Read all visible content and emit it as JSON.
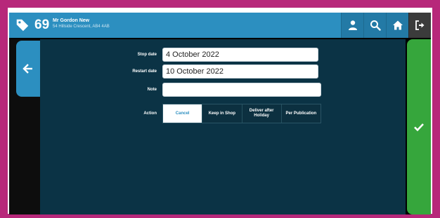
{
  "header": {
    "customer_number": "69",
    "customer_name": "Mr Gordon New",
    "customer_address": "54 Hillside Crescent, AB4 4AB"
  },
  "form": {
    "stop_date_label": "Stop date",
    "stop_date_value": "4 October 2022",
    "restart_date_label": "Restart date",
    "restart_date_value": "10 October 2022",
    "note_label": "Note",
    "note_value": "",
    "action_label": "Action",
    "actions": [
      {
        "label": "Cancel",
        "selected": true
      },
      {
        "label": "Keep in Shop",
        "selected": false
      },
      {
        "label": "Deliver after Holiday",
        "selected": false
      },
      {
        "label": "Per Publication",
        "selected": false
      }
    ]
  },
  "colors": {
    "header": "#2c8fc0",
    "content_bg": "#0b3345",
    "confirm": "#36a63c",
    "frame": "#b7287a"
  },
  "icons": {
    "customer": "tag-icon",
    "back": "arrow-left-icon",
    "confirm": "checkmark-icon",
    "user": "user-icon",
    "search": "search-icon",
    "home": "home-icon",
    "logout": "sign-out-icon"
  }
}
